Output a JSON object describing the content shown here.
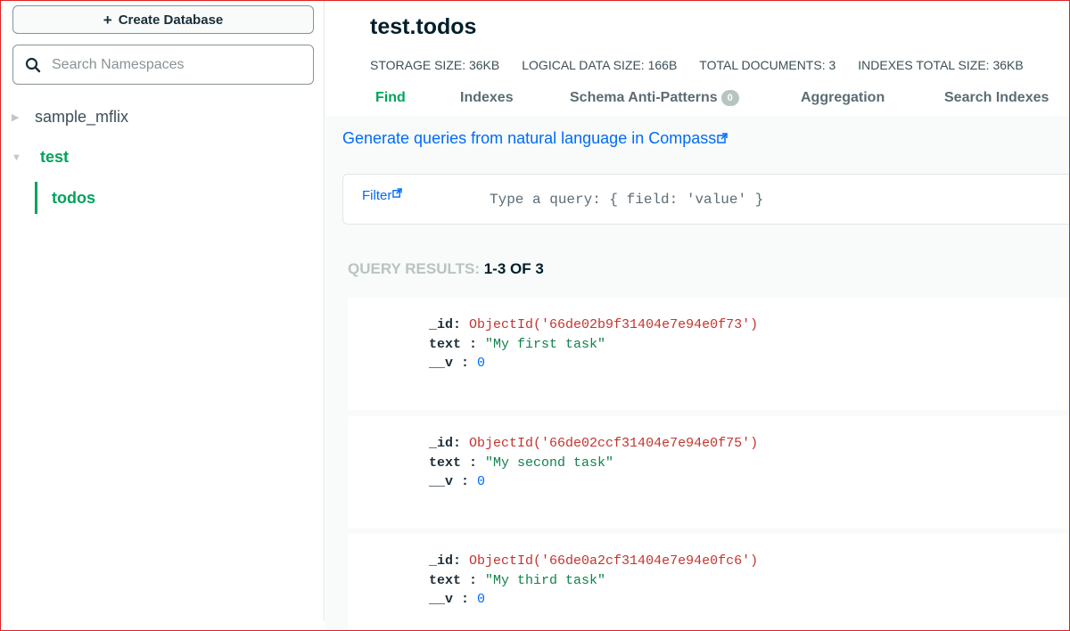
{
  "sidebar": {
    "create_label": "Create Database",
    "search_placeholder": "Search Namespaces",
    "databases": [
      {
        "name": "sample_mflix",
        "expanded": false
      },
      {
        "name": "test",
        "expanded": true,
        "collections": [
          "todos"
        ]
      }
    ]
  },
  "header": {
    "title": "test.todos",
    "stats": {
      "storage": "STORAGE SIZE: 36KB",
      "logical": "LOGICAL DATA SIZE: 166B",
      "documents": "TOTAL DOCUMENTS: 3",
      "indexes": "INDEXES TOTAL SIZE: 36KB"
    },
    "tabs": [
      {
        "label": "Find",
        "active": true
      },
      {
        "label": "Indexes"
      },
      {
        "label": "Schema Anti-Patterns",
        "badge": "0"
      },
      {
        "label": "Aggregation"
      },
      {
        "label": "Search Indexes"
      }
    ]
  },
  "query": {
    "nl_link": "Generate queries from natural language in Compass",
    "filter_label": "Filter",
    "filter_placeholder": "Type a query: { field: 'value' }"
  },
  "results": {
    "label": "QUERY RESULTS:",
    "count": "1-3 OF 3",
    "documents": [
      {
        "id_key": "_id",
        "id": "ObjectId('66de02b9f31404e7e94e0f73')",
        "text_key": "text",
        "text": "\"My first task\"",
        "v_key": "__v",
        "v": "0"
      },
      {
        "id_key": "_id",
        "id": "ObjectId('66de02ccf31404e7e94e0f75')",
        "text_key": "text",
        "text": "\"My second task\"",
        "v_key": "__v",
        "v": "0"
      },
      {
        "id_key": "_id",
        "id": "ObjectId('66de0a2cf31404e7e94e0fc6')",
        "text_key": "text",
        "text": "\"My third task\"",
        "v_key": "__v",
        "v": "0"
      }
    ]
  },
  "colors": {
    "accent_green": "#00a35c",
    "link_blue": "#016bf8",
    "objectid_red": "#c2352f",
    "string_green": "#12824d"
  },
  "icons": [
    "plus-icon",
    "search-icon",
    "caret-right-icon",
    "caret-down-icon",
    "external-link-icon"
  ]
}
